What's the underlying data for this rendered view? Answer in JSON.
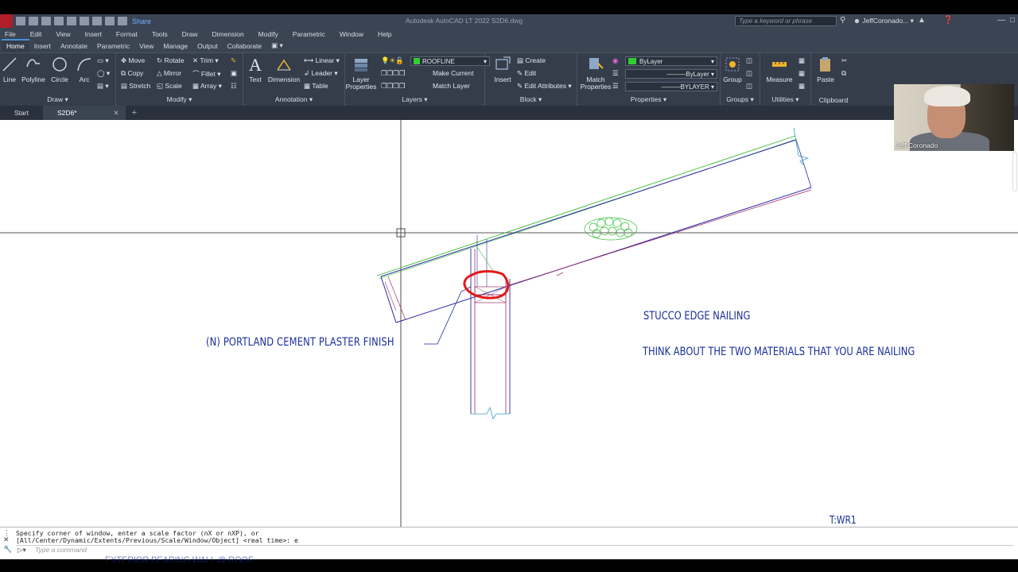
{
  "titlebar": {
    "share": "Share",
    "title": "Autodesk AutoCAD LT 2022    S2D6.dwg",
    "search_placeholder": "Type a keyword or phrase",
    "user": "JeffCoronado..."
  },
  "menu": [
    "File",
    "Edit",
    "View",
    "Insert",
    "Format",
    "Tools",
    "Draw",
    "Dimension",
    "Modify",
    "Parametric",
    "Window",
    "Help"
  ],
  "ribbon_tabs": [
    "Home",
    "Insert",
    "Annotate",
    "Parametric",
    "View",
    "Manage",
    "Output",
    "Collaborate"
  ],
  "ribbon": {
    "draw": {
      "label": "Draw",
      "line": "Line",
      "polyline": "Polyline",
      "circle": "Circle",
      "arc": "Arc"
    },
    "modify": {
      "label": "Modify",
      "move": "Move",
      "rotate": "Rotate",
      "trim": "Trim",
      "copy": "Copy",
      "mirror": "Mirror",
      "fillet": "Fillet",
      "stretch": "Stretch",
      "scale": "Scale",
      "array": "Array"
    },
    "annotation": {
      "label": "Annotation",
      "text": "Text",
      "dimension": "Dimension",
      "linear": "Linear",
      "leader": "Leader",
      "table": "Table"
    },
    "layers": {
      "label": "Layers",
      "layer_properties": "Layer Properties",
      "current_layer": "ROOFLINE",
      "make_current": "Make Current",
      "match_layer": "Match Layer"
    },
    "block": {
      "label": "Block",
      "insert": "Insert",
      "create": "Create",
      "edit": "Edit",
      "edit_attributes": "Edit Attributes"
    },
    "properties": {
      "label": "Properties",
      "match_properties": "Match Properties",
      "color": "ByLayer",
      "linetype": "ByLayer",
      "lineweight": "BYLAYER"
    },
    "groups": {
      "label": "Groups",
      "group": "Group"
    },
    "utilities": {
      "label": "Utilities",
      "measure": "Measure"
    },
    "clipboard": {
      "label": "Clipboard",
      "paste": "Paste"
    }
  },
  "doc_tabs": {
    "start": "Start",
    "active": "S2D6*"
  },
  "webcam": {
    "name": "Jeff Coronado"
  },
  "drawing": {
    "note_plaster": "(N) PORTLAND CEMENT PLASTER FINISH",
    "note_title": "STUCCO EDGE NAILING",
    "note_think": "THINK ABOUT THE TWO MATERIALS THAT YOU ARE NAILING",
    "tag": "T:WR1",
    "partial_label": "EXTERIOR BEARING WALL @ ROOF"
  },
  "command": {
    "line1": "Specify corner of window, enter a scale factor (nX or nXP), or",
    "line2": "[All/Center/Dynamic/Extents/Previous/Scale/Window/Object] <real time>: e",
    "placeholder": "Type a command"
  },
  "colors": {
    "ribbon_bg": "#353d4b",
    "accent": "#4a8fd8",
    "annotation_blue": "#1a2f9a",
    "markup_red": "#e01a1a",
    "layer_green": "#33cc33"
  }
}
